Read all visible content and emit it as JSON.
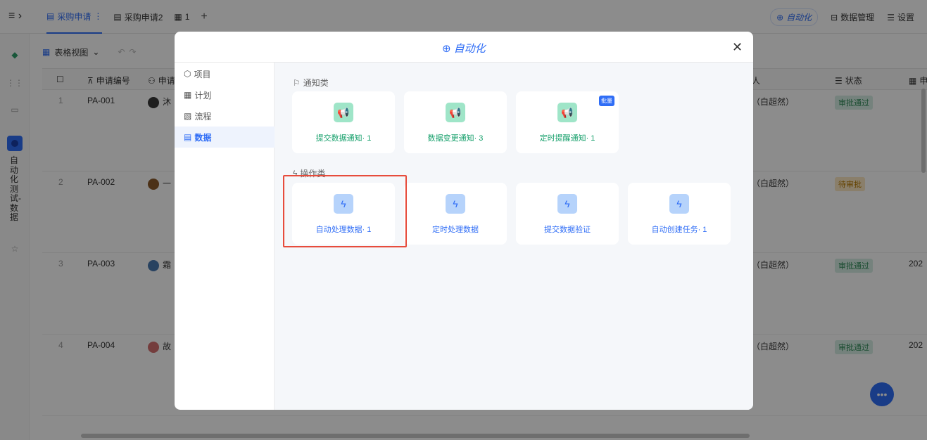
{
  "topbar": {
    "tabs": [
      {
        "label": "采购申请",
        "active": true
      },
      {
        "label": "采购申请2",
        "active": false
      },
      {
        "label": "1",
        "active": false
      }
    ],
    "auto_label": "自动化",
    "data_manage_label": "数据管理",
    "settings_label": "设置"
  },
  "leftrail": {
    "app_name_vertical": "自动化测试-数据"
  },
  "toolbar": {
    "view_label": "表格视图"
  },
  "table": {
    "headers": [
      "申请编号",
      "申请",
      "人",
      "状态",
      "申"
    ],
    "rows": [
      {
        "num": "1",
        "id": "PA-001",
        "applicant": "沐",
        "person": "（白超然）",
        "status": "审批通过",
        "date": ""
      },
      {
        "num": "2",
        "id": "PA-002",
        "applicant": "一",
        "person": "（白超然）",
        "status": "待审批",
        "date": ""
      },
      {
        "num": "3",
        "id": "PA-003",
        "applicant": "霜",
        "person": "（白超然）",
        "status": "审批通过",
        "date": "202"
      },
      {
        "num": "4",
        "id": "PA-004",
        "applicant": "故",
        "person": "（白超然）",
        "status": "审批通过",
        "date": "202"
      }
    ]
  },
  "modal": {
    "title": "自动化",
    "nav": [
      {
        "label": "项目",
        "active": false
      },
      {
        "label": "计划",
        "active": false
      },
      {
        "label": "流程",
        "active": false
      },
      {
        "label": "数据",
        "active": true
      }
    ],
    "notify_section": "通知类",
    "notify_cards": [
      {
        "label": "提交数据通知· 1",
        "badge": ""
      },
      {
        "label": "数据变更通知· 3",
        "badge": ""
      },
      {
        "label": "定时提醒通知· 1",
        "badge": "批量"
      }
    ],
    "action_section": "操作类",
    "action_cards": [
      {
        "label": "自动处理数据· 1"
      },
      {
        "label": "定时处理数据"
      },
      {
        "label": "提交数据验证"
      },
      {
        "label": "自动创建任务· 1"
      }
    ]
  },
  "colors": {
    "accent": "#2f6df6",
    "notify_green": "#16a06b",
    "highlight": "#e74c3c"
  }
}
